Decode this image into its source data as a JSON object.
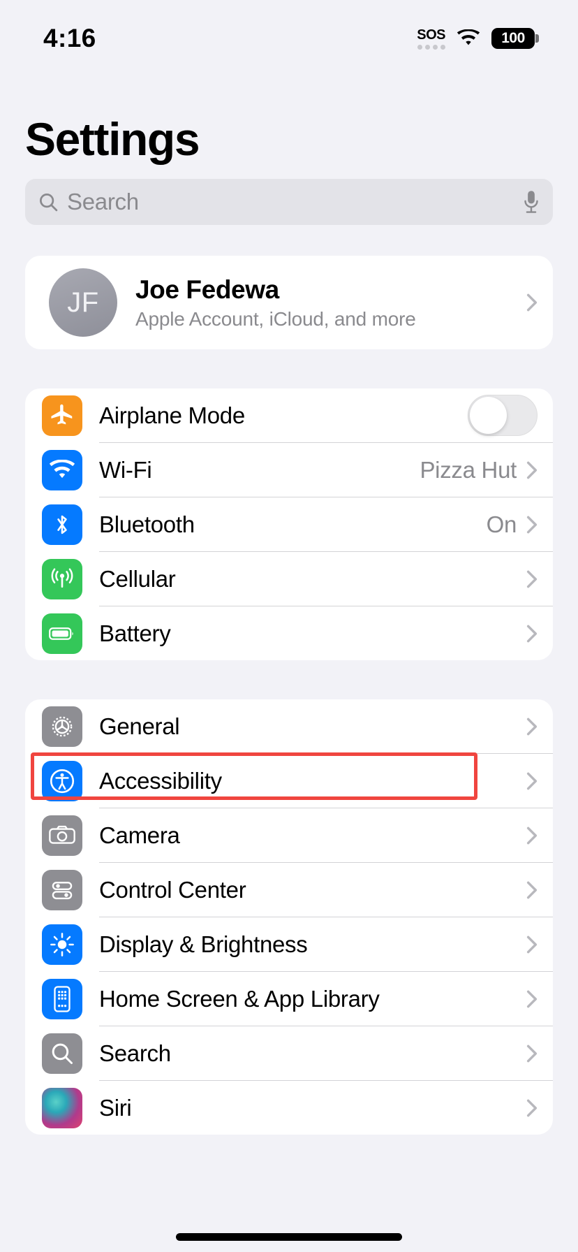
{
  "status_bar": {
    "time": "4:16",
    "sos_label": "SOS",
    "wifi_icon": "wifi-icon",
    "battery_level": "100"
  },
  "header": {
    "title": "Settings"
  },
  "search": {
    "placeholder": "Search",
    "search_icon": "search-icon",
    "mic_icon": "microphone-icon"
  },
  "profile": {
    "initials": "JF",
    "name": "Joe Fedewa",
    "subtitle": "Apple Account, iCloud, and more",
    "chevron_icon": "chevron-right-icon"
  },
  "colors": {
    "background": "#f2f2f7",
    "card": "#ffffff",
    "separator": "#d3d3d6",
    "secondary_text": "#8a8a8e",
    "highlight": "#f0453f",
    "orange": "#f7941d",
    "blue": "#057aff",
    "green": "#34c759",
    "gray": "#8e8e93"
  },
  "groups": [
    {
      "name": "connectivity-group",
      "rows": [
        {
          "label": "Airplane Mode",
          "icon": "airplane-icon",
          "icon_color": "#f7941d",
          "accessory": "toggle",
          "toggle_on": false,
          "value": ""
        },
        {
          "label": "Wi-Fi",
          "icon": "wifi-icon",
          "icon_color": "#057aff",
          "accessory": "chevron",
          "value": "Pizza Hut"
        },
        {
          "label": "Bluetooth",
          "icon": "bluetooth-icon",
          "icon_color": "#057aff",
          "accessory": "chevron",
          "value": "On"
        },
        {
          "label": "Cellular",
          "icon": "cellular-icon",
          "icon_color": "#34c759",
          "accessory": "chevron",
          "value": ""
        },
        {
          "label": "Battery",
          "icon": "battery-icon",
          "icon_color": "#34c759",
          "accessory": "chevron",
          "value": ""
        }
      ]
    },
    {
      "name": "system-group",
      "rows": [
        {
          "label": "General",
          "icon": "gear-icon",
          "icon_color": "#8e8e93",
          "accessory": "chevron",
          "value": ""
        },
        {
          "label": "Accessibility",
          "icon": "accessibility-icon",
          "icon_color": "#057aff",
          "accessory": "chevron",
          "value": "",
          "highlighted": true
        },
        {
          "label": "Camera",
          "icon": "camera-icon",
          "icon_color": "#8e8e93",
          "accessory": "chevron",
          "value": ""
        },
        {
          "label": "Control Center",
          "icon": "control-center-icon",
          "icon_color": "#8e8e93",
          "accessory": "chevron",
          "value": ""
        },
        {
          "label": "Display & Brightness",
          "icon": "brightness-icon",
          "icon_color": "#057aff",
          "accessory": "chevron",
          "value": ""
        },
        {
          "label": "Home Screen & App Library",
          "icon": "home-screen-icon",
          "icon_color": "#057aff",
          "accessory": "chevron",
          "value": ""
        },
        {
          "label": "Search",
          "icon": "search-icon",
          "icon_color": "#8e8e93",
          "accessory": "chevron",
          "value": ""
        },
        {
          "label": "Siri",
          "icon": "siri-icon",
          "icon_color": "#d64f8c",
          "accessory": "chevron",
          "value": ""
        }
      ]
    }
  ]
}
